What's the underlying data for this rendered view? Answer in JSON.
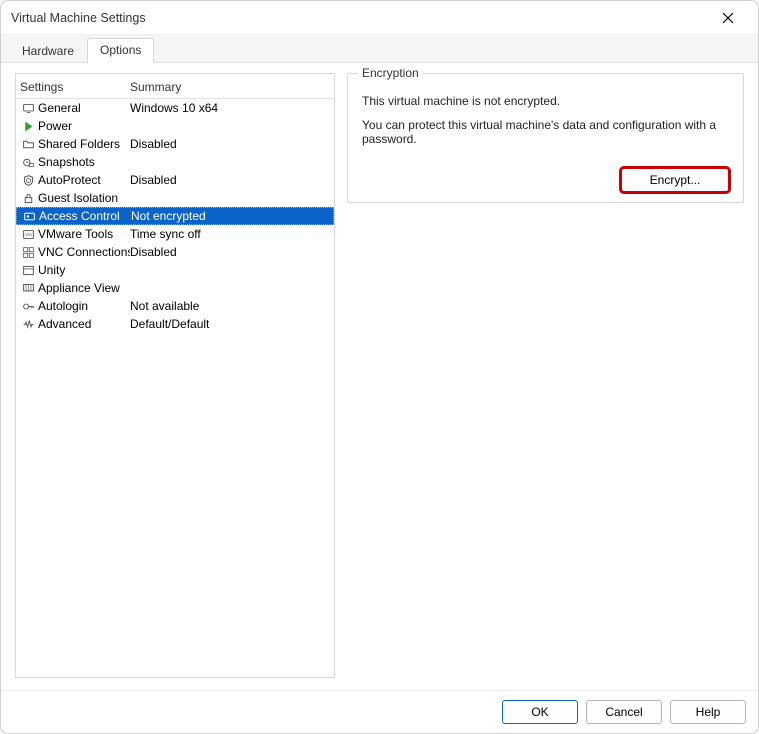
{
  "window": {
    "title": "Virtual Machine Settings"
  },
  "tabs": {
    "hardware": "Hardware",
    "options": "Options",
    "selected": "options"
  },
  "list": {
    "header_settings": "Settings",
    "header_summary": "Summary",
    "rows": [
      {
        "name": "General",
        "summary": "Windows 10 x64",
        "icon": "monitor"
      },
      {
        "name": "Power",
        "summary": "",
        "icon": "play"
      },
      {
        "name": "Shared Folders",
        "summary": "Disabled",
        "icon": "folder"
      },
      {
        "name": "Snapshots",
        "summary": "",
        "icon": "clock-camera"
      },
      {
        "name": "AutoProtect",
        "summary": "Disabled",
        "icon": "shield-clock"
      },
      {
        "name": "Guest Isolation",
        "summary": "",
        "icon": "lock"
      },
      {
        "name": "Access Control",
        "summary": "Not encrypted",
        "icon": "keycard"
      },
      {
        "name": "VMware Tools",
        "summary": "Time sync off",
        "icon": "vm-box"
      },
      {
        "name": "VNC Connections",
        "summary": "Disabled",
        "icon": "grid"
      },
      {
        "name": "Unity",
        "summary": "",
        "icon": "window"
      },
      {
        "name": "Appliance View",
        "summary": "",
        "icon": "monitor-grid"
      },
      {
        "name": "Autologin",
        "summary": "Not available",
        "icon": "key"
      },
      {
        "name": "Advanced",
        "summary": "Default/Default",
        "icon": "waveform"
      }
    ],
    "selected_index": 6
  },
  "panel": {
    "group_title": "Encryption",
    "line1": "This virtual machine is not encrypted.",
    "line2": "You can protect this virtual machine's data and configuration with a password.",
    "encrypt_label": "Encrypt..."
  },
  "footer": {
    "ok": "OK",
    "cancel": "Cancel",
    "help": "Help"
  }
}
